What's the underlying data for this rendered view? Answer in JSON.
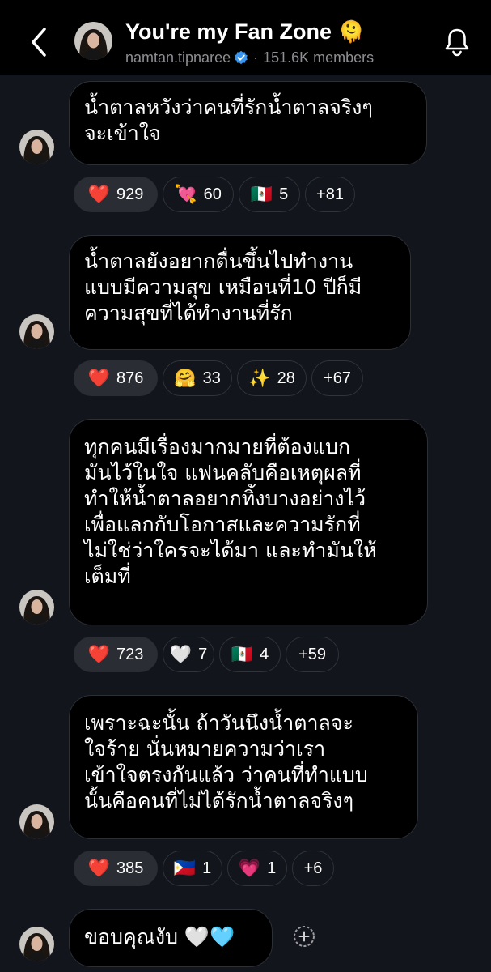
{
  "header": {
    "title": "You're my Fan Zone",
    "title_emoji": "🫠",
    "username": "namtan.tipnaree",
    "separator": "·",
    "members": "151.6K members",
    "verified_color": "#3897f0"
  },
  "messages": [
    {
      "lines": [
        "น้ำตาลหวังว่าคนที่รักน้ำตาลจริงๆ",
        "จะเข้าใจ"
      ],
      "reactions": [
        {
          "emoji": "❤️",
          "count": "929",
          "own": true
        },
        {
          "emoji": "💘",
          "count": "60",
          "own": false
        },
        {
          "emoji": "🇲🇽",
          "count": "5",
          "own": false
        },
        {
          "emoji": "",
          "count": "+81",
          "own": false
        }
      ]
    },
    {
      "lines": [
        "น้ำตาลยังอยากตื่นขึ้นไปทำงาน",
        "แบบมีความสุข เหมือนที่10 ปีก็มี",
        "ความสุขที่ได้ทำงานที่รัก"
      ],
      "reactions": [
        {
          "emoji": "❤️",
          "count": "876",
          "own": true
        },
        {
          "emoji": "🤗",
          "count": "33",
          "own": false
        },
        {
          "emoji": "✨",
          "count": "28",
          "own": false
        },
        {
          "emoji": "",
          "count": "+67",
          "own": false
        }
      ]
    },
    {
      "lines": [
        "ทุกคนมีเรื่องมากมายที่ต้องแบก",
        "มันไว้ในใจ แฟนคลับคือเหตุผลที่",
        "ทำให้น้ำตาลอยากทิ้งบางอย่างไว้",
        "เพื่อแลกกับโอกาสและความรักที่",
        "ไม่ใช่ว่าใครจะได้มา และทำมันให้",
        "เต็มที่"
      ],
      "reactions": [
        {
          "emoji": "❤️",
          "count": "723",
          "own": true
        },
        {
          "emoji": "🤍",
          "count": "7",
          "own": false
        },
        {
          "emoji": "🇲🇽",
          "count": "4",
          "own": false
        },
        {
          "emoji": "",
          "count": "+59",
          "own": false
        }
      ]
    },
    {
      "lines": [
        "เพราะฉะนั้น ถ้าวันนึงน้ำตาลจะ",
        "ใจร้าย นั่นหมายความว่าเรา",
        "เข้าใจตรงกันแล้ว ว่าคนที่ทำแบบ",
        "นั้นคือคนที่ไม่ได้รักน้ำตาลจริงๆ"
      ],
      "reactions": [
        {
          "emoji": "❤️",
          "count": "385",
          "own": true
        },
        {
          "emoji": "🇵🇭",
          "count": "1",
          "own": false
        },
        {
          "emoji": "💗",
          "count": "1",
          "own": false
        },
        {
          "emoji": "",
          "count": "+6",
          "own": false
        }
      ]
    },
    {
      "lines": [
        "ขอบคุณงับ 🤍🩵"
      ],
      "reactions": []
    }
  ]
}
